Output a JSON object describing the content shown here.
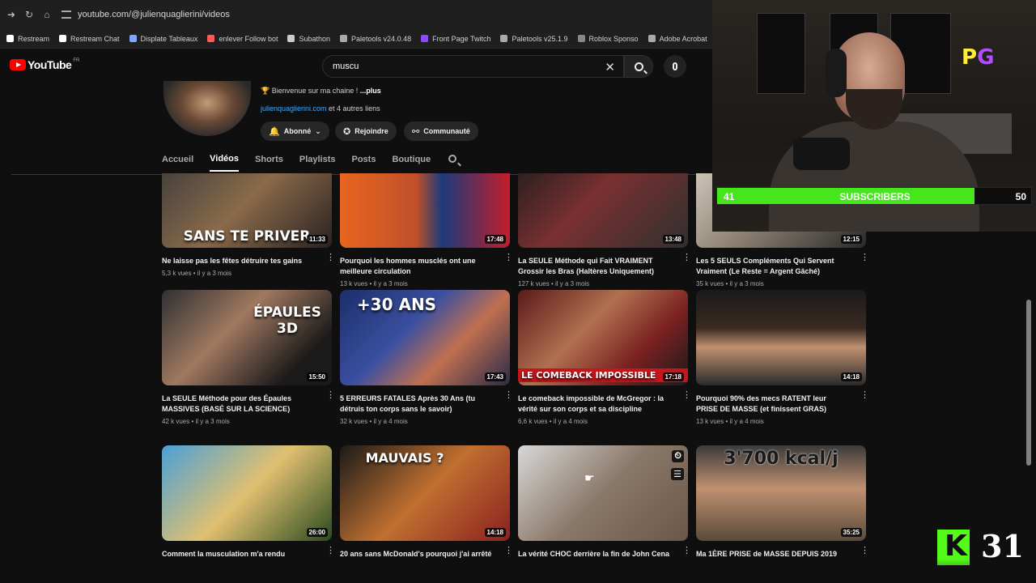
{
  "browser": {
    "url": "youtube.com/@julienquaglierini/videos",
    "bookmarks": [
      {
        "label": "Restream",
        "color": "#ffffff"
      },
      {
        "label": "Restream Chat",
        "color": "#ffffff"
      },
      {
        "label": "Displate Tableaux",
        "color": "#7fa7ff"
      },
      {
        "label": "enlever Follow bot",
        "color": "#ff5a5a"
      },
      {
        "label": "Subathon",
        "color": "#cccccc"
      },
      {
        "label": "Paletools v24.0.48",
        "color": "#aaaaaa"
      },
      {
        "label": "Front Page Twitch",
        "color": "#9147ff"
      },
      {
        "label": "Paletools v25.1.9",
        "color": "#aaaaaa"
      },
      {
        "label": "Roblox Sponso",
        "color": "#888888"
      },
      {
        "label": "Adobe Acrobat",
        "color": "#aaaaaa"
      }
    ]
  },
  "youtube": {
    "logo_text": "YouTube",
    "region": "FR",
    "search_value": "muscu"
  },
  "channel": {
    "description": "🏆 Bienvenue sur ma chaine ! ",
    "more": "...plus",
    "link": "julienquaglierini.com",
    "other_links": " et 4 autres liens",
    "subscribed_label": "Abonné",
    "join_label": "Rejoindre",
    "community_label": "Communauté"
  },
  "tabs": [
    "Accueil",
    "Vidéos",
    "Shorts",
    "Playlists",
    "Posts",
    "Boutique"
  ],
  "active_tab": "Vidéos",
  "videos": [
    {
      "title": "Ne laisse pas les fêtes détruire tes gains",
      "meta": "5,3 k vues • il y a 3 mois",
      "duration": "11:33",
      "overlay": "SANS TE PRIVER",
      "bg": "linear-gradient(135deg,#3a3a3a,#8a6a4a 50%,#2a2220)"
    },
    {
      "title": "Pourquoi les hommes musclés ont une meilleure circulation",
      "meta": "13 k vues • il y a 3 mois",
      "duration": "17:48",
      "overlay": "",
      "bg": "linear-gradient(90deg,#e8651f 0%,#c0502a 45%,#1b3a7a 60%,#c41e2a 100%)"
    },
    {
      "title": "La SEULE Méthode qui Fait VRAIMENT Grossir les Bras (Haltères Uniquement)",
      "meta": "127 k vues • il y a 3 mois",
      "duration": "13:48",
      "overlay": "",
      "bg": "linear-gradient(135deg,#1c1c1c,#7a3030 45%,#303030)"
    },
    {
      "title": "Les 5 SEULS Compléments Qui Servent Vraiment (Le Reste = Argent Gâché)",
      "meta": "35 k vues • il y a 3 mois",
      "duration": "12:15",
      "overlay": "",
      "bg": "linear-gradient(135deg,#d8d0c4,#8a7e70 50%,#2a2a2a)"
    },
    {
      "title": "La SEULE Méthode pour des Épaules MASSIVES (BASÉ SUR LA SCIENCE)",
      "meta": "42 k vues • il y a 3 mois",
      "duration": "15:50",
      "overlay": "ÉPAULES 3D",
      "bg": "linear-gradient(135deg,#2e3033,#a07860 40%,#1a1a1a 80%)"
    },
    {
      "title": "5 ERREURS FATALES Après 30 Ans (tu détruis ton corps sans le savoir)",
      "meta": "32 k vues • il y a 4 mois",
      "duration": "17:43",
      "overlay": "+30 ANS",
      "bg": "linear-gradient(135deg,#1b2f6a,#3b4fa0 40%,#c07050 65%,#2a2a4a)"
    },
    {
      "title": "Le comeback impossible de McGregor : la vérité sur son corps et sa discipline",
      "meta": "6,6 k vues • il y a 4 mois",
      "duration": "17:18",
      "overlay": "LE COMEBACK IMPOSSIBLE",
      "bg": "linear-gradient(135deg,#5a1a1a,#b07050 40%,#7a2020 70%,#1a1a1a)"
    },
    {
      "title": "Pourquoi 90% des mecs RATENT leur PRISE DE MASSE (et finissent GRAS)",
      "meta": "13 k vues • il y a 4 mois",
      "duration": "14:18",
      "overlay": "",
      "bg": "linear-gradient(180deg,#1a1a1a,#3a2a22 40%,#c09070 60%,#2a2a2a)"
    },
    {
      "title": "Comment la musculation m'a rendu",
      "meta": "",
      "duration": "26:00",
      "overlay": "",
      "bg": "linear-gradient(135deg,#4aa0d8,#e0c070 50%,#2a4a20)"
    },
    {
      "title": "20 ans sans McDonald's pourquoi j'ai arrêté",
      "meta": "",
      "duration": "14:18",
      "overlay": "MAUVAIS ?",
      "bg": "linear-gradient(135deg,#1a1a1a,#c07030 50%,#8a2020)"
    },
    {
      "title": "La vérité CHOC derrière la fin de John Cena",
      "meta": "",
      "duration": "",
      "overlay": "",
      "bg": "linear-gradient(135deg,#d8d8d8,#8a7868 50%,#6a5648)"
    },
    {
      "title": "Ma 1ÈRE PRISE de MASSE DEPUIS 2019",
      "meta": "",
      "duration": "35:25",
      "overlay": "3'700 kcal/j",
      "bg": "linear-gradient(180deg,#3a3a3a,#c09070 45%,#5a4a3a)"
    }
  ],
  "overlay": {
    "pg_p": "P",
    "pg_g": "G",
    "subscribers_label": "SUBSCRIBERS",
    "subscribers_current": "41",
    "subscribers_goal": "50",
    "subscribers_progress": 0.82,
    "kick_letter": "K",
    "kick_viewers": "31"
  }
}
